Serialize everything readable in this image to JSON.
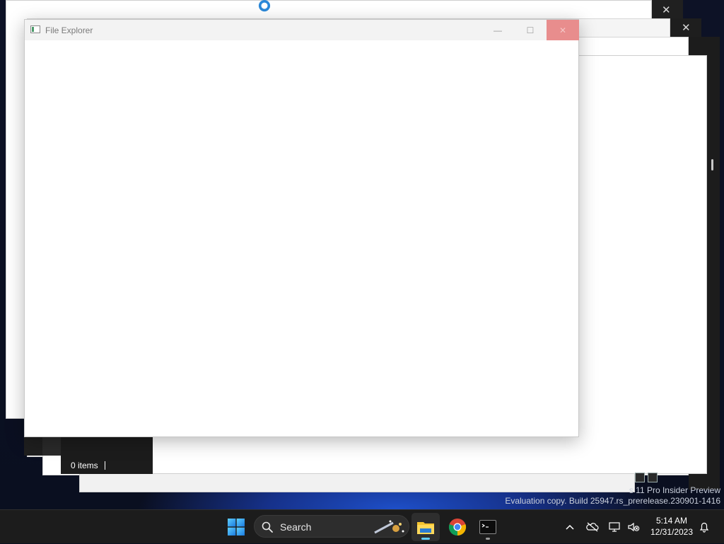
{
  "explorer": {
    "title": "File Explorer",
    "minimize_glyph": "—",
    "maximize_glyph": "☐",
    "close_glyph": "✕"
  },
  "background_windows": {
    "status_items": "0 items",
    "close_glyph": "✕"
  },
  "watermark": {
    "line1": "s 11 Pro Insider Preview",
    "line2": "Evaluation copy. Build 25947.rs_prerelease.230901-1416"
  },
  "taskbar": {
    "search_label": "Search",
    "apps": [
      "File Explorer",
      "Google Chrome",
      "Terminal"
    ],
    "tray_icons": [
      "chevron-up-icon",
      "network-disconnected-icon",
      "display-network-icon",
      "volume-muted-icon",
      "notification-bell-icon"
    ],
    "time": "5:14 AM",
    "date": "12/31/2023"
  },
  "colors": {
    "accent": "#60cdff",
    "close_hover": "#e88d8d",
    "taskbar_bg": "#1c1c1c"
  }
}
